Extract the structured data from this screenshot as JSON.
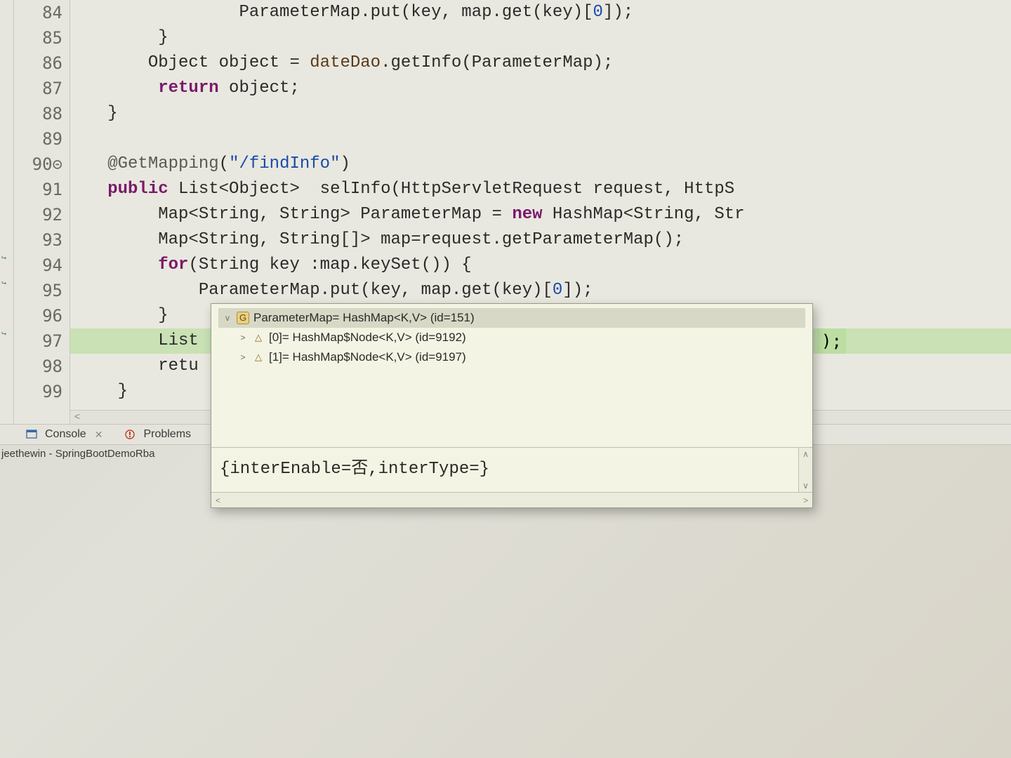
{
  "editor": {
    "lines": [
      {
        "num": "84",
        "tokens": [
          {
            "t": "                ParameterMap.put(key, map.get(key)[",
            "c": ""
          },
          {
            "t": "0",
            "c": "num"
          },
          {
            "t": "]);",
            "c": ""
          }
        ]
      },
      {
        "num": "85",
        "tokens": [
          {
            "t": "        }",
            "c": ""
          }
        ]
      },
      {
        "num": "86",
        "tokens": [
          {
            "t": "       Object object = ",
            "c": ""
          },
          {
            "t": "dateDao",
            "c": "mvar"
          },
          {
            "t": ".getInfo(ParameterMap);",
            "c": ""
          }
        ]
      },
      {
        "num": "87",
        "tokens": [
          {
            "t": "        ",
            "c": ""
          },
          {
            "t": "return",
            "c": "kw"
          },
          {
            "t": " object;",
            "c": ""
          }
        ]
      },
      {
        "num": "88",
        "tokens": [
          {
            "t": "   }",
            "c": ""
          }
        ]
      },
      {
        "num": "89",
        "tokens": [
          {
            "t": "",
            "c": ""
          }
        ]
      },
      {
        "num": "90⊝",
        "tokens": [
          {
            "t": "   ",
            "c": ""
          },
          {
            "t": "@GetMapping",
            "c": "ann"
          },
          {
            "t": "(",
            "c": ""
          },
          {
            "t": "\"/findInfo\"",
            "c": "str"
          },
          {
            "t": ")",
            "c": ""
          }
        ]
      },
      {
        "num": "91",
        "tokens": [
          {
            "t": "   ",
            "c": ""
          },
          {
            "t": "public",
            "c": "kw"
          },
          {
            "t": " List<Object>  selInfo(HttpServletRequest request, HttpS",
            "c": ""
          }
        ]
      },
      {
        "num": "92",
        "tokens": [
          {
            "t": "        Map<String, String> ParameterMap = ",
            "c": ""
          },
          {
            "t": "new",
            "c": "kw"
          },
          {
            "t": " HashMap<String, Str",
            "c": ""
          }
        ]
      },
      {
        "num": "93",
        "tokens": [
          {
            "t": "        Map<String, String[]> map=request.getParameterMap();",
            "c": ""
          }
        ]
      },
      {
        "num": "94",
        "tokens": [
          {
            "t": "        ",
            "c": ""
          },
          {
            "t": "for",
            "c": "kw"
          },
          {
            "t": "(String key :map.keySet()) {",
            "c": ""
          }
        ]
      },
      {
        "num": "95",
        "tokens": [
          {
            "t": "            ParameterMap.put(key, map.get(key)[",
            "c": ""
          },
          {
            "t": "0",
            "c": "num"
          },
          {
            "t": "]);",
            "c": ""
          }
        ]
      },
      {
        "num": "96",
        "tokens": [
          {
            "t": "        }",
            "c": ""
          }
        ]
      },
      {
        "num": "97",
        "highlight": true,
        "tokens": [
          {
            "t": "        List",
            "c": ""
          }
        ]
      },
      {
        "num": "98",
        "tokens": [
          {
            "t": "        retu",
            "c": ""
          }
        ]
      },
      {
        "num": "99",
        "tokens": [
          {
            "t": "    }",
            "c": ""
          }
        ]
      }
    ],
    "tail_after_popup": ");"
  },
  "hover": {
    "tree": [
      {
        "depth": 0,
        "twisty": "v",
        "iconClass": "var",
        "iconText": "G",
        "label": "ParameterMap= HashMap<K,V>  (id=151)",
        "selected": true
      },
      {
        "depth": 1,
        "twisty": ">",
        "iconClass": "arr",
        "iconText": "△",
        "label": "[0]= HashMap$Node<K,V>  (id=9192)",
        "selected": false
      },
      {
        "depth": 1,
        "twisty": ">",
        "iconClass": "arr",
        "iconText": "△",
        "label": "[1]= HashMap$Node<K,V>  (id=9197)",
        "selected": false
      }
    ],
    "detail": "{interEnable=否,interType=}",
    "scroll_left": "<",
    "scroll_right": ">",
    "scroll_up": "∧",
    "scroll_down": "∨"
  },
  "views": {
    "console_label": "Console",
    "console_x": "✕",
    "problems_label": "Problems"
  },
  "launch": "jeethewin - SpringBootDemoRba",
  "hscroll_left": "<",
  "markers": {
    "94": "↪",
    "95": "↪",
    "97": "↪"
  }
}
